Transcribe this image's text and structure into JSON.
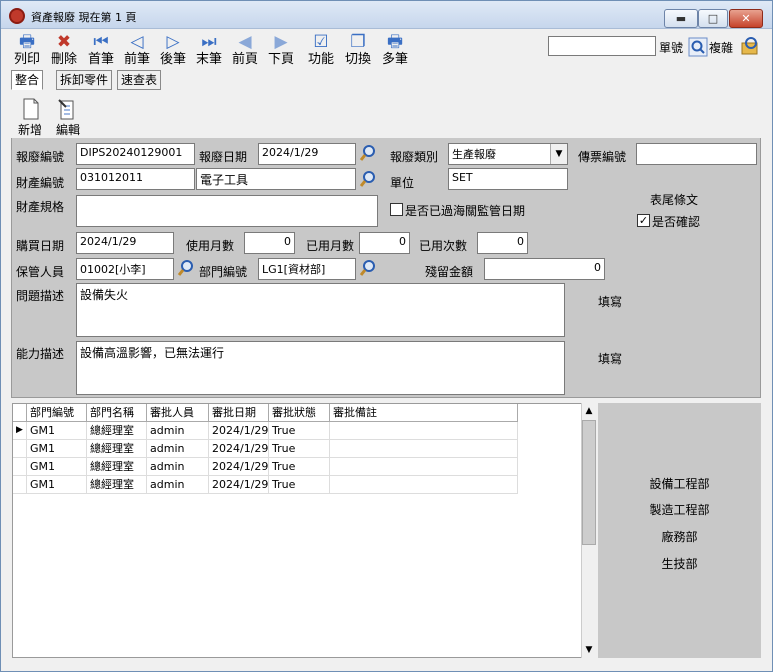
{
  "window": {
    "title": "資產報廢 現在第 1 頁",
    "min": "▬",
    "max": "□",
    "close": "✕"
  },
  "toolbar": [
    {
      "label": "列印",
      "icon": "printer-icon",
      "glyph": "🖶"
    },
    {
      "label": "刪除",
      "icon": "delete-icon",
      "glyph": "✖"
    },
    {
      "label": "首筆",
      "icon": "first-record-icon",
      "glyph": "⏮"
    },
    {
      "label": "前筆",
      "icon": "prev-record-icon",
      "glyph": "◁"
    },
    {
      "label": "後筆",
      "icon": "next-record-icon",
      "glyph": "▷"
    },
    {
      "label": "末筆",
      "icon": "last-record-icon",
      "glyph": "⏭"
    },
    {
      "label": "前頁",
      "icon": "prev-page-icon",
      "glyph": "◀"
    },
    {
      "label": "下頁",
      "icon": "next-page-icon",
      "glyph": "▶"
    },
    {
      "label": "功能",
      "icon": "function-icon",
      "glyph": "☑"
    },
    {
      "label": "切換",
      "icon": "switch-icon",
      "glyph": "❐"
    },
    {
      "label": "多筆",
      "icon": "multi-record-icon",
      "glyph": "🖶"
    }
  ],
  "search": {
    "value": "",
    "label_no": "單號",
    "label_copy": "複雜"
  },
  "tabs": [
    "整合",
    "拆卸零件",
    "速查表"
  ],
  "subtoolbar": {
    "new": "新增",
    "edit": "編輯"
  },
  "form": {
    "scrap_no_label": "報廢編號",
    "scrap_no": "DIPS20240129001",
    "scrap_date_label": "報廢日期",
    "scrap_date": "2024/1/29",
    "scrap_type_label": "報廢類別",
    "scrap_type": "生產報廢",
    "voucher_label": "傳票編號",
    "voucher": "",
    "asset_no_label": "財產編號",
    "asset_no": "031012011",
    "asset_name": "電子工具",
    "unit_label": "單位",
    "unit": "SET",
    "end_clause": "表尾條文",
    "spec_label": "財產規格",
    "spec": "",
    "customs_check": "是否已過海關監管日期",
    "confirm_check": "是否確認",
    "purchase_date_label": "購買日期",
    "purchase_date": "2024/1/29",
    "use_months_label": "使用月數",
    "use_months": "0",
    "used_months_label": "已用月數",
    "used_months": "0",
    "used_times_label": "已用次數",
    "used_times": "0",
    "keeper_label": "保管人員",
    "keeper": "01002[小李]",
    "dept_label": "部門編號",
    "dept": "LG1[資材部]",
    "residual_label": "殘留金額",
    "residual": "0",
    "problem_label": "問題描述",
    "problem": "設備失火",
    "fill1": "填寫",
    "ability_label": "能力描述",
    "ability": "設備高溫影響，已無法運行",
    "fill2": "填寫"
  },
  "grid": {
    "headers": [
      "部門編號",
      "部門名稱",
      "審批人員",
      "審批日期",
      "審批狀態",
      "審批備註"
    ],
    "rows": [
      [
        "GM1",
        "總經理室",
        "admin",
        "2024/1/29 ",
        "True",
        ""
      ],
      [
        "GM1",
        "總經理室",
        "admin",
        "2024/1/29 ",
        "True",
        ""
      ],
      [
        "GM1",
        "總經理室",
        "admin",
        "2024/1/29 ",
        "True",
        ""
      ],
      [
        "GM1",
        "總經理室",
        "admin",
        "2024/1/29 ",
        "True",
        ""
      ]
    ]
  },
  "departments": [
    "設備工程部",
    "製造工程部",
    "廠務部",
    "生技部"
  ]
}
